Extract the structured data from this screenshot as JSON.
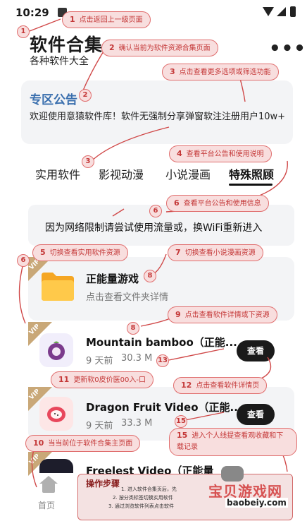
{
  "status_bar": {
    "time": "10:29"
  },
  "header": {
    "title": "软件合集",
    "subtitle": "各种软件大全",
    "more_label": "•••"
  },
  "notice": {
    "title": "专区公告",
    "text": "欢迎使用意猿软件库！软件无强制分享弹窗软注注册用户10w+"
  },
  "tabs": [
    {
      "label": "实用软件",
      "active": false
    },
    {
      "label": "影视动漫",
      "active": false
    },
    {
      "label": "小说漫画",
      "active": false
    },
    {
      "label": "特殊照顾",
      "active": true
    }
  ],
  "network_tip": "因为网络限制请尝试使用流量或，换WiFi重新进入",
  "items": [
    {
      "name": "正能量游戏",
      "meta": "点击查看文件夹详情",
      "vip": "VIP"
    },
    {
      "name": "Mountain bamboo（正能...",
      "meta": "9 天前",
      "size": "30.3 M",
      "button": "查看",
      "vip": "VIP"
    },
    {
      "name": "Dragon Fruit Video（正能...",
      "meta": "9 天前",
      "size": "33.3 M",
      "button": "查看",
      "vip": "VIP"
    },
    {
      "name": "Freelest Video（正能量",
      "vip": "VIP"
    }
  ],
  "annotations": [
    {
      "num": "1",
      "text": "点击返回上一级页面"
    },
    {
      "num": "2",
      "text": "确认当前为软件资源合集页面"
    },
    {
      "num": "3",
      "text": "点击查看更多选项或筛选功能"
    },
    {
      "num": "4",
      "text": "查看平台公告和使用说明"
    },
    {
      "num": "5",
      "text": "切换查看实用软件资源"
    },
    {
      "num": "6",
      "text": "查看平台公告和使用信息"
    },
    {
      "num": "7",
      "text": "切换查看小说漫画资源"
    },
    {
      "num": "9",
      "text": "点击查看软件详情或下资源"
    },
    {
      "num": "10",
      "text": "当当前位于软件合集主页面"
    },
    {
      "num": "11",
      "text": "更新软0皮价医00入-口"
    },
    {
      "num": "12",
      "text": "点击查看软件详情页"
    },
    {
      "num": "15",
      "text": "进入个人线提查看观收藏和下载记录"
    }
  ],
  "circle_markers": [
    "1",
    "2",
    "3",
    "6",
    "6",
    "8",
    "8",
    "13",
    "15"
  ],
  "bottom_nav": {
    "home_label": "首页"
  },
  "steps_panel": {
    "title": "操作步骤",
    "lines": [
      "1. 进入软件合集页后，先",
      "2. 按分类标签切换实用软件",
      "3. 通过浏览软件列表点击软件"
    ]
  },
  "watermark": {
    "main": "宝贝游戏网",
    "url": "baobeiy.com"
  }
}
